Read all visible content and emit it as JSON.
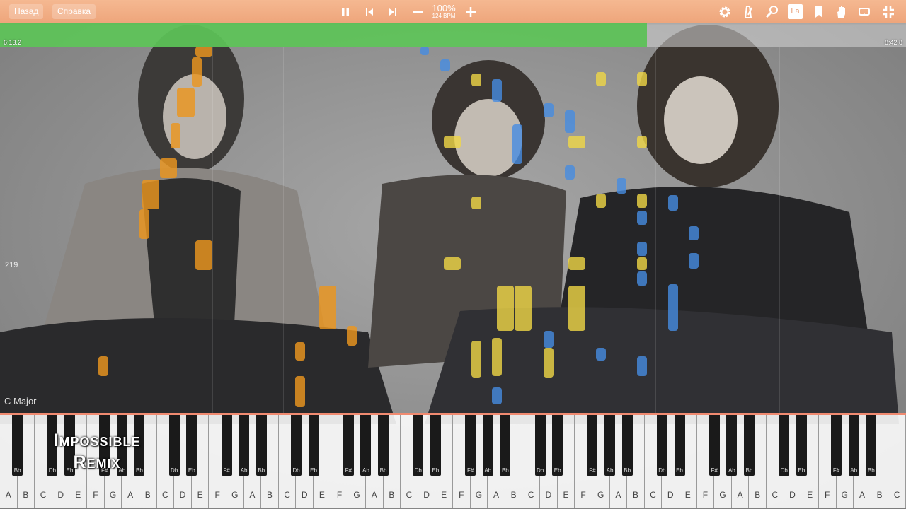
{
  "toolbar": {
    "back_label": "Назад",
    "help_label": "Справка",
    "zoom": "100%",
    "bpm": "124 BPM",
    "note_name_label": "La",
    "icons": [
      "pause-icon",
      "prev-icon",
      "next-icon",
      "minus-icon",
      "plus-icon",
      "gear-icon",
      "metronome-icon",
      "search-icon",
      "note-name-icon",
      "bookmark-icon",
      "hand-icon",
      "loop-icon",
      "exit-fullscreen-icon"
    ]
  },
  "progress": {
    "current_time": "6:13.2",
    "total_time": "8:42.8",
    "fraction": 0.714
  },
  "overlay": {
    "measure": "219",
    "key": "C Major"
  },
  "logo": {
    "line1": "Impossible",
    "line2": "Remix"
  },
  "keyboard": {
    "white_keys": [
      "A",
      "B",
      "C",
      "D",
      "E",
      "F",
      "G",
      "A",
      "B",
      "C",
      "D",
      "E",
      "F",
      "G",
      "A",
      "B",
      "C",
      "D",
      "E",
      "F",
      "G",
      "A",
      "B",
      "C",
      "D",
      "E",
      "F",
      "G",
      "A",
      "B",
      "C",
      "D",
      "E",
      "F",
      "G",
      "A",
      "B",
      "C",
      "D",
      "E",
      "F",
      "G",
      "A",
      "B",
      "C",
      "D",
      "E",
      "F",
      "G",
      "A",
      "B",
      "C"
    ],
    "black_keys": [
      "Bb",
      "Db",
      "Eb",
      "F#",
      "Ab",
      "Bb",
      "Db",
      "Eb",
      "F#",
      "Ab",
      "Bb",
      "Db",
      "Eb",
      "F#",
      "Ab",
      "Bb",
      "Db",
      "Eb",
      "F#",
      "Ab",
      "Bb",
      "Db",
      "Eb",
      "F#",
      "Ab",
      "Bb",
      "Db",
      "Eb",
      "F#",
      "Ab",
      "Bb",
      "Db",
      "Eb",
      "F#",
      "Ab",
      "Bb"
    ]
  },
  "colors": {
    "toolbar": "#eea57b",
    "progress": "#4cc346",
    "left_hand": "#ec961e",
    "right_hand": "#f0d746",
    "extra": "#468ce1"
  }
}
